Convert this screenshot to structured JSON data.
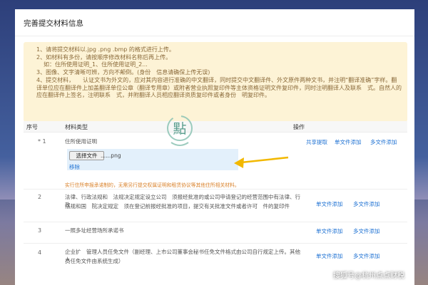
{
  "page": {
    "title": "完善提交材料信息"
  },
  "notice": {
    "line1": "1、请将提交材料以.jpg .png .bmp 的格式进行上传。",
    "line2": "2、如材料有多份，请按顺序修改材料名称后再上传。",
    "line3": "如：住所使用证明_1、住所使用证明_2...",
    "line4": "3、图像、文字清晰可辨，方向不颠倒。(身份　信息请确保上传无误)",
    "line5": "4、提交材料，　　认证文书为外文的，应对其内容进行准确的中文翻译，同时提交中文翻译件、外文原件两种文书，并注明“翻译准确”字样。翻译单位应在翻译件上加盖翻译单位公章（翻译专用章）或附者营业执照复印件等主体资格证明文件复印件，同时注明翻译人及联系　式。自然人的应在翻译件上签名，注明联系　式，并附翻译人员相应翻译资质复印件或者身份　明复印件。"
  },
  "table": {
    "headers": {
      "num": "序号",
      "type": "材料类型",
      "ops": "操作"
    },
    "rows": [
      {
        "num": "* 1",
        "name": "住所使用证明",
        "actions": [
          "共享提取",
          "单文件添加",
          "多文件添加"
        ],
        "upload": {
          "button": "选择文件",
          "file": "......png",
          "remove": "移除"
        },
        "warning": "实行住所申报承诺制的，无需另行提交权属证明和租赁协议等其他住所相关材料。"
      },
      {
        "num": "2",
        "name_line1": "法律、行政法规和　法规决定规定设立公司　须报经批准的或公司申请登记的经营范围中有法律、行政",
        "name_line2": "法规和国　院决定规定　须在登记前报经批准的项目，提交有关批准文件或者许可　件的复印件",
        "actions": [
          "单文件添加",
          "多文件添加"
        ]
      },
      {
        "num": "3",
        "name": "一照多址经营场所承诺书",
        "actions": [
          "单文件添加",
          "多文件添加"
        ]
      },
      {
        "num": "4",
        "name_line1": "企业扩　管理人员任免文件（副经理、上市公司董事会秘书任免文件格式由公司自行规定上传。其他人",
        "name_line2": "员任免文件由系统生成）",
        "actions": [
          "单文件添加",
          "多文件添加"
        ]
      }
    ]
  },
  "watermark": {
    "char": "點"
  },
  "credit": "搜狐号@杭州点点财税",
  "colors": {
    "link": "#1f72d3",
    "notice_bg": "#fdf3d6",
    "notice_text": "#8a6a3a",
    "warning": "#d9822b",
    "arrow": "#f2b800"
  }
}
